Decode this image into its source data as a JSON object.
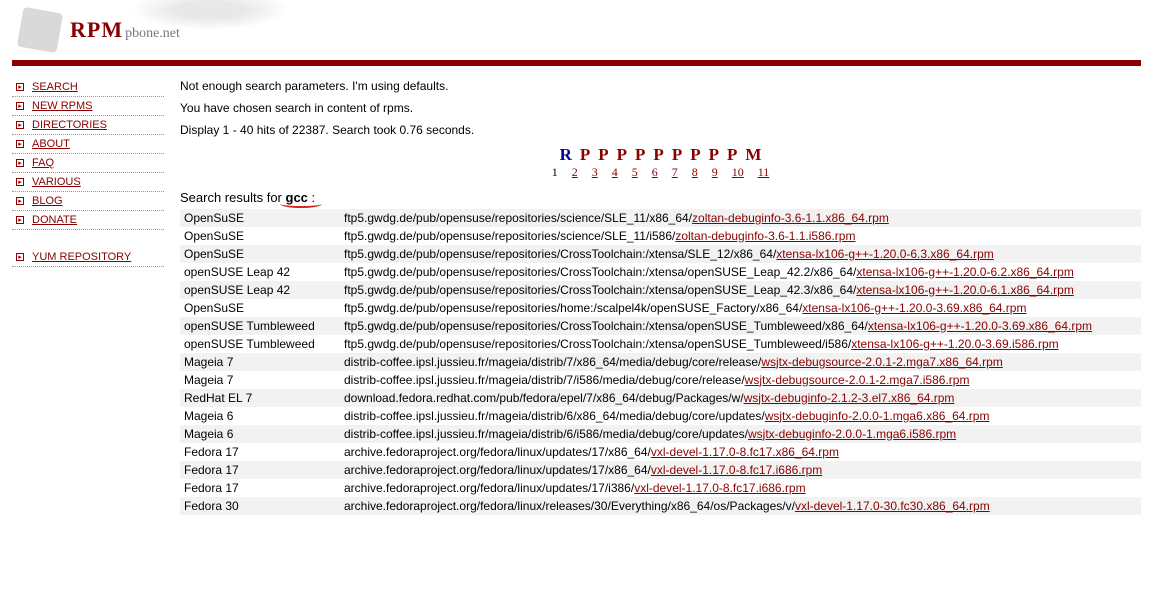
{
  "logo": {
    "rpm": "RPM",
    "sub": "pbone.net"
  },
  "nav": {
    "items": [
      "SEARCH",
      "NEW RPMS",
      "DIRECTORIES",
      "ABOUT",
      "FAQ",
      "VARIOUS",
      "BLOG",
      "DONATE"
    ],
    "extra": [
      "YUM REPOSITORY"
    ]
  },
  "messages": {
    "l1": "Not enough search parameters. I'm using defaults.",
    "l2": "You have chosen search in content of rpms.",
    "l3": "Display 1 - 40 hits of 22387. Search took 0.76 seconds."
  },
  "pager": {
    "letters": [
      "R",
      "P",
      "P",
      "P",
      "P",
      "P",
      "P",
      "P",
      "P",
      "P",
      "M"
    ],
    "pages": [
      "1",
      "2",
      "3",
      "4",
      "5",
      "6",
      "7",
      "8",
      "9",
      "10",
      "11"
    ],
    "current": "1"
  },
  "search": {
    "prefix": "Search results for ",
    "term": "gcc",
    "suffix": " :"
  },
  "rows": [
    {
      "distro": "OpenSuSE",
      "path": "ftp5.gwdg.de/pub/opensuse/repositories/science/SLE_11/x86_64/",
      "link": "zoltan-debuginfo-3.6-1.1.x86_64.rpm"
    },
    {
      "distro": "OpenSuSE",
      "path": "ftp5.gwdg.de/pub/opensuse/repositories/science/SLE_11/i586/",
      "link": "zoltan-debuginfo-3.6-1.1.i586.rpm"
    },
    {
      "distro": "OpenSuSE",
      "path": "ftp5.gwdg.de/pub/opensuse/repositories/CrossToolchain:/xtensa/SLE_12/x86_64/",
      "link": "xtensa-lx106-g++-1.20.0-6.3.x86_64.rpm"
    },
    {
      "distro": "openSUSE Leap 42",
      "path": "ftp5.gwdg.de/pub/opensuse/repositories/CrossToolchain:/xtensa/openSUSE_Leap_42.2/x86_64/",
      "link": "xtensa-lx106-g++-1.20.0-6.2.x86_64.rpm"
    },
    {
      "distro": "openSUSE Leap 42",
      "path": "ftp5.gwdg.de/pub/opensuse/repositories/CrossToolchain:/xtensa/openSUSE_Leap_42.3/x86_64/",
      "link": "xtensa-lx106-g++-1.20.0-6.1.x86_64.rpm"
    },
    {
      "distro": "OpenSuSE",
      "path": "ftp5.gwdg.de/pub/opensuse/repositories/home:/scalpel4k/openSUSE_Factory/x86_64/",
      "link": "xtensa-lx106-g++-1.20.0-3.69.x86_64.rpm"
    },
    {
      "distro": "openSUSE Tumbleweed",
      "path": "ftp5.gwdg.de/pub/opensuse/repositories/CrossToolchain:/xtensa/openSUSE_Tumbleweed/x86_64/",
      "link": "xtensa-lx106-g++-1.20.0-3.69.x86_64.rpm"
    },
    {
      "distro": "openSUSE Tumbleweed",
      "path": "ftp5.gwdg.de/pub/opensuse/repositories/CrossToolchain:/xtensa/openSUSE_Tumbleweed/i586/",
      "link": "xtensa-lx106-g++-1.20.0-3.69.i586.rpm"
    },
    {
      "distro": "Mageia 7",
      "path": "distrib-coffee.ipsl.jussieu.fr/mageia/distrib/7/x86_64/media/debug/core/release/",
      "link": "wsjtx-debugsource-2.0.1-2.mga7.x86_64.rpm"
    },
    {
      "distro": "Mageia 7",
      "path": "distrib-coffee.ipsl.jussieu.fr/mageia/distrib/7/i586/media/debug/core/release/",
      "link": "wsjtx-debugsource-2.0.1-2.mga7.i586.rpm"
    },
    {
      "distro": "RedHat EL 7",
      "path": "download.fedora.redhat.com/pub/fedora/epel/7/x86_64/debug/Packages/w/",
      "link": "wsjtx-debuginfo-2.1.2-3.el7.x86_64.rpm"
    },
    {
      "distro": "Mageia 6",
      "path": "distrib-coffee.ipsl.jussieu.fr/mageia/distrib/6/x86_64/media/debug/core/updates/",
      "link": "wsjtx-debuginfo-2.0.0-1.mga6.x86_64.rpm"
    },
    {
      "distro": "Mageia 6",
      "path": "distrib-coffee.ipsl.jussieu.fr/mageia/distrib/6/i586/media/debug/core/updates/",
      "link": "wsjtx-debuginfo-2.0.0-1.mga6.i586.rpm"
    },
    {
      "distro": "Fedora 17",
      "path": "archive.fedoraproject.org/fedora/linux/updates/17/x86_64/",
      "link": "vxl-devel-1.17.0-8.fc17.x86_64.rpm"
    },
    {
      "distro": "Fedora 17",
      "path": "archive.fedoraproject.org/fedora/linux/updates/17/x86_64/",
      "link": "vxl-devel-1.17.0-8.fc17.i686.rpm"
    },
    {
      "distro": "Fedora 17",
      "path": "archive.fedoraproject.org/fedora/linux/updates/17/i386/",
      "link": "vxl-devel-1.17.0-8.fc17.i686.rpm"
    },
    {
      "distro": "Fedora 30",
      "path": "archive.fedoraproject.org/fedora/linux/releases/30/Everything/x86_64/os/Packages/v/",
      "link": "vxl-devel-1.17.0-30.fc30.x86_64.rpm"
    }
  ]
}
